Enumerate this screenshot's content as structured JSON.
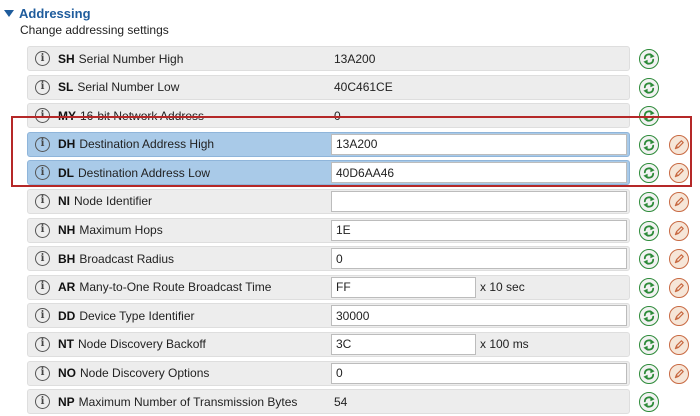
{
  "section": {
    "title": "Addressing",
    "subtitle": "Change addressing settings"
  },
  "icons": {
    "info": "info-icon",
    "read": "refresh-arrows-icon",
    "write": "pencil-icon",
    "collapse": "caret-down-icon"
  },
  "colors": {
    "section_title": "#1f5c9c",
    "row_background": "#ededed",
    "row_highlight": "#a9cae8",
    "read_icon": "#2e8b3a",
    "write_icon": "#c86a43",
    "callout_box": "#b52828"
  },
  "params": [
    {
      "code": "SH",
      "name": "Serial Number High",
      "value": "13A200",
      "editable": false,
      "highlight": false
    },
    {
      "code": "SL",
      "name": "Serial Number Low",
      "value": "40C461CE",
      "editable": false,
      "highlight": false
    },
    {
      "code": "MY",
      "name": "16-bit Network Address",
      "value": "0",
      "editable": false,
      "highlight": false
    },
    {
      "code": "DH",
      "name": "Destination Address High",
      "value": "13A200",
      "editable": true,
      "highlight": true
    },
    {
      "code": "DL",
      "name": "Destination Address Low",
      "value": "40D6AA46",
      "editable": true,
      "highlight": true
    },
    {
      "code": "NI",
      "name": "Node Identifier",
      "value": "",
      "editable": true,
      "highlight": false
    },
    {
      "code": "NH",
      "name": "Maximum Hops",
      "value": "1E",
      "editable": true,
      "highlight": false
    },
    {
      "code": "BH",
      "name": "Broadcast Radius",
      "value": "0",
      "editable": true,
      "highlight": false
    },
    {
      "code": "AR",
      "name": "Many-to-One Route Broadcast Time",
      "value": "FF",
      "editable": true,
      "highlight": false,
      "suffix": "x 10 sec"
    },
    {
      "code": "DD",
      "name": "Device Type Identifier",
      "value": "30000",
      "editable": true,
      "highlight": false
    },
    {
      "code": "NT",
      "name": "Node Discovery Backoff",
      "value": "3C",
      "editable": true,
      "highlight": false,
      "suffix": "x 100 ms"
    },
    {
      "code": "NO",
      "name": "Node Discovery Options",
      "value": "0",
      "editable": true,
      "highlight": false
    },
    {
      "code": "NP",
      "name": "Maximum Number of Transmission Bytes",
      "value": "54",
      "editable": false,
      "highlight": false
    }
  ]
}
